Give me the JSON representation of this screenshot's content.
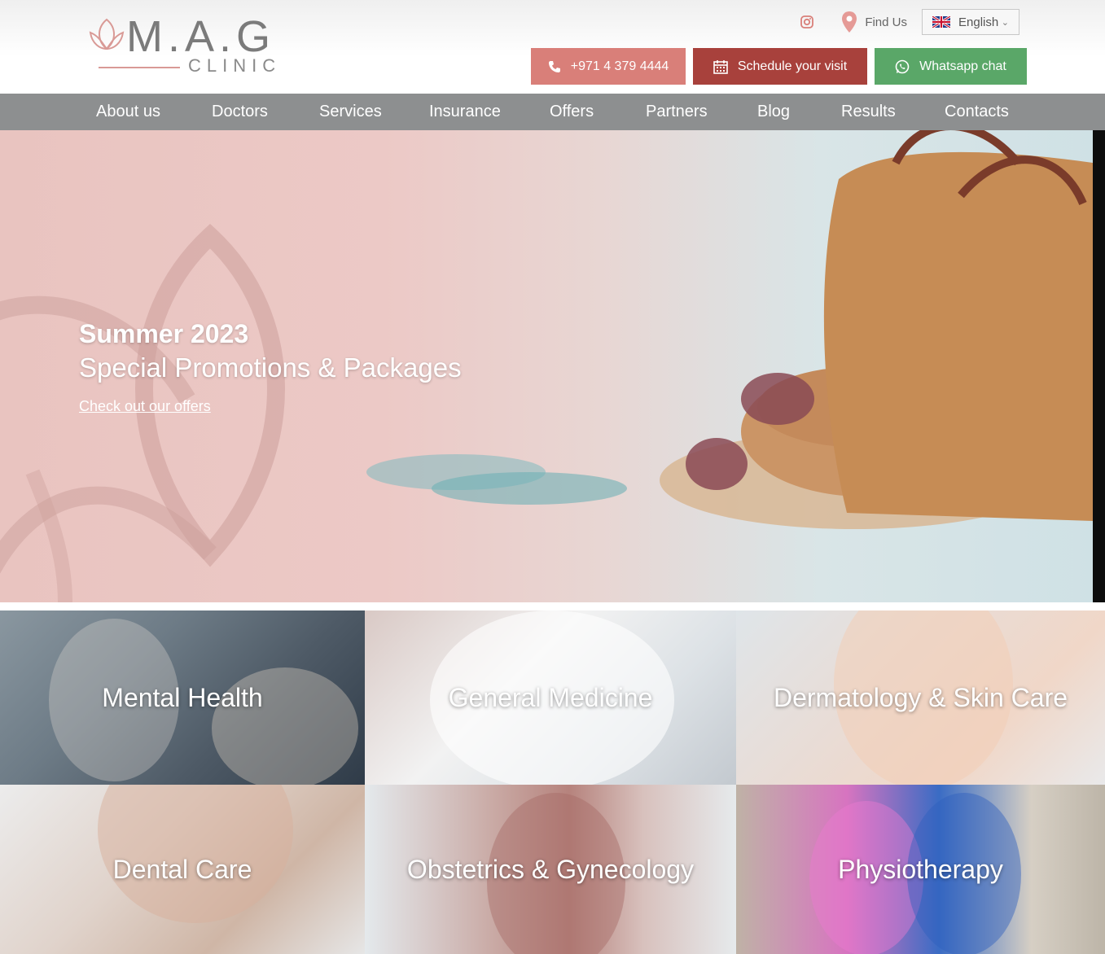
{
  "header": {
    "logo_title": "M.A.G",
    "logo_subtitle": "CLINIC",
    "find_us": "Find Us",
    "language": "English",
    "phone_button": "+971 4 379 4444",
    "visit_button": "Schedule your visit",
    "whatsapp_button": "Whatsapp chat"
  },
  "nav": {
    "items": [
      "About us",
      "Doctors",
      "Services",
      "Insurance",
      "Offers",
      "Partners",
      "Blog",
      "Results",
      "Contacts"
    ]
  },
  "hero": {
    "title": "Summer 2023",
    "subtitle": "Special Promotions & Packages",
    "link": "Check out our offers"
  },
  "tiles": [
    {
      "label": "Mental Health"
    },
    {
      "label": "General Medicine"
    },
    {
      "label": "Dermatology & Skin Care"
    },
    {
      "label": "Dental Care"
    },
    {
      "label": "Obstetrics & Gynecology"
    },
    {
      "label": "Physiotherapy"
    }
  ],
  "colors": {
    "nav_bg": "#8d8f90",
    "phone_btn": "#d97f79",
    "visit_btn": "#a8413c",
    "whatsapp_btn": "#5aa768",
    "brand_pink": "#d99a96"
  }
}
